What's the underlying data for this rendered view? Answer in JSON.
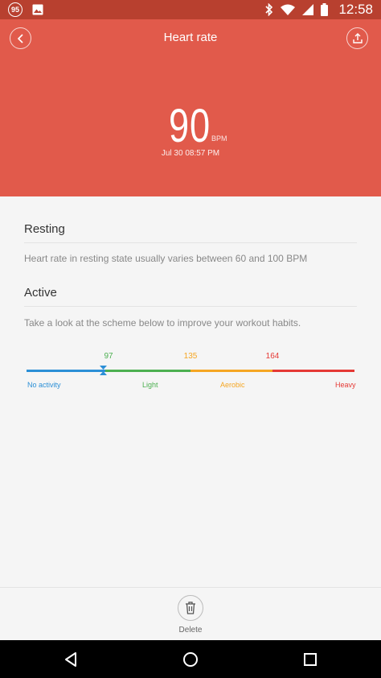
{
  "status_bar": {
    "notification_count": "95",
    "time": "12:58",
    "icons": [
      "notification-badge",
      "image-icon",
      "bluetooth-icon",
      "wifi-icon",
      "signal-icon",
      "battery-icon"
    ]
  },
  "header": {
    "title": "Heart rate",
    "back_icon": "chevron-left-icon",
    "share_icon": "share-icon",
    "background_color": "#e15a4b"
  },
  "reading": {
    "value": "90",
    "unit": "BPM",
    "timestamp": "Jul 30 08:57 PM"
  },
  "resting": {
    "title": "Resting",
    "text": "Heart rate in resting state usually varies between 60 and 100 BPM"
  },
  "active": {
    "title": "Active",
    "text": "Take a look at the scheme below to improve your workout habits.",
    "thresholds": [
      {
        "value": "97",
        "color": "#4caf50"
      },
      {
        "value": "135",
        "color": "#f5a623"
      },
      {
        "value": "164",
        "color": "#e53935"
      }
    ],
    "zones": [
      {
        "label": "No activity",
        "color": "#2b8fd6"
      },
      {
        "label": "Light",
        "color": "#4caf50"
      },
      {
        "label": "Aerobic",
        "color": "#f5a623"
      },
      {
        "label": "Heavy",
        "color": "#e53935"
      }
    ],
    "current_value": 90
  },
  "footer": {
    "delete_label": "Delete",
    "delete_icon": "trash-icon"
  },
  "nav_bar": {
    "icons": [
      "back-icon",
      "home-icon",
      "recents-icon"
    ]
  }
}
